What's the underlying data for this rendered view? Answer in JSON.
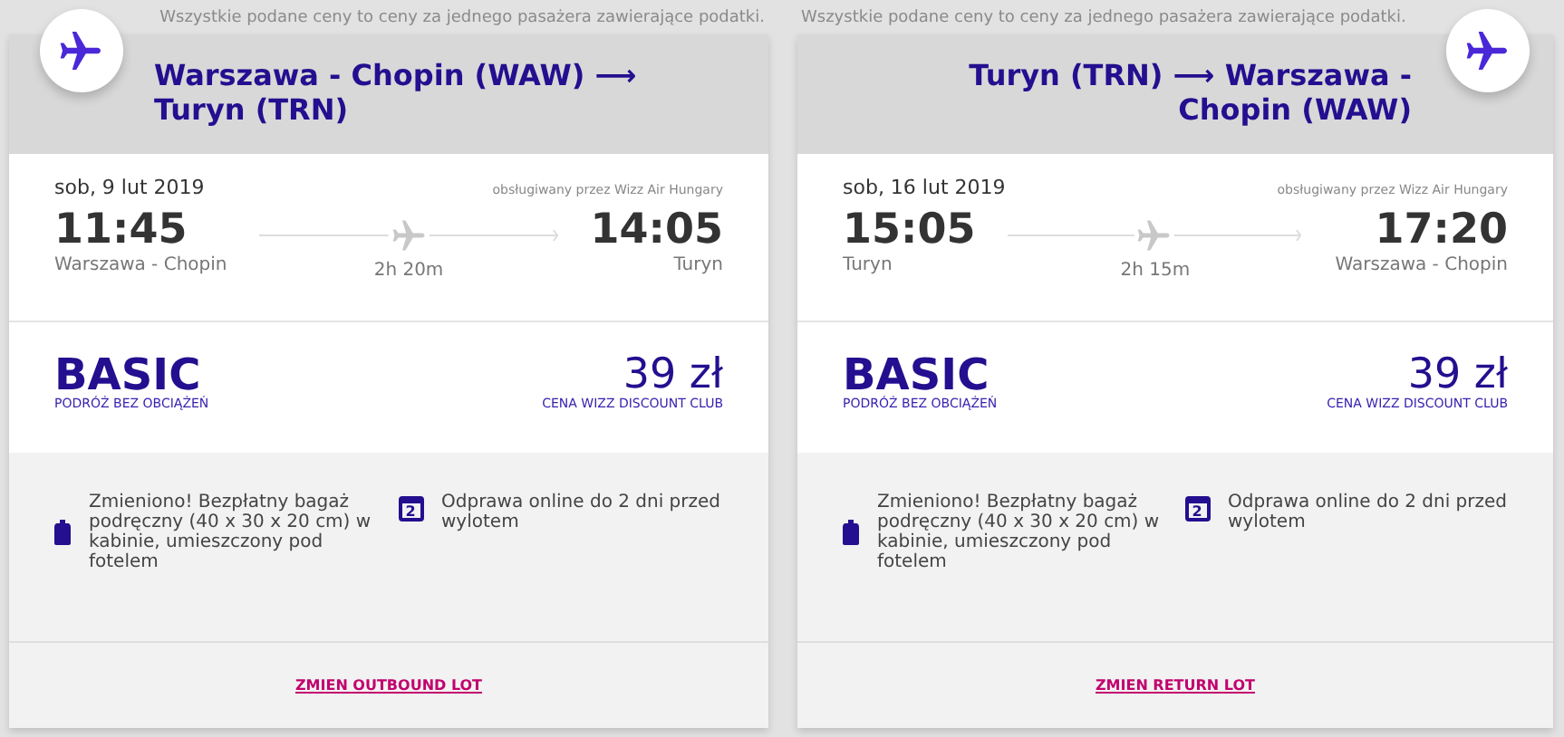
{
  "flights": [
    {
      "note": "Wszystkie podane ceny to ceny za jednego pasażera zawierające podatki.",
      "route": "Warszawa - Chopin (WAW) ⟶ Turyn (TRN)",
      "date": "sob, 9 lut 2019",
      "operator": "obsługiwany przez Wizz Air Hungary",
      "departure_time": "11:45",
      "departure_airport": "Warszawa - Chopin",
      "duration": "2h 20m",
      "arrival_time": "14:05",
      "arrival_airport": "Turyn",
      "fare": "BASIC",
      "fare_subtitle": "PODRÓŻ BEZ OBCIĄŻEŃ",
      "price": "39 zł",
      "price_note": "CENA WIZZ DISCOUNT CLUB",
      "features": [
        {
          "kind": "bag",
          "text": "Zmieniono! Bezpłatny bagaż podręczny (40 x 30 x 20 cm) w kabinie, umieszczony pod fotelem"
        },
        {
          "kind": "calendar",
          "icon_text": "2",
          "text": "Odprawa online do 2 dni przed wylotem"
        }
      ],
      "change_link": "ZMIEN OUTBOUND LOT"
    },
    {
      "note": "Wszystkie podane ceny to ceny za jednego pasażera zawierające podatki.",
      "route": "Turyn (TRN) ⟶ Warszawa - Chopin (WAW)",
      "date": "sob, 16 lut 2019",
      "operator": "obsługiwany przez Wizz Air Hungary",
      "departure_time": "15:05",
      "departure_airport": "Turyn",
      "duration": "2h 15m",
      "arrival_time": "17:20",
      "arrival_airport": "Warszawa - Chopin",
      "fare": "BASIC",
      "fare_subtitle": "PODRÓŻ BEZ OBCIĄŻEŃ",
      "price": "39 zł",
      "price_note": "CENA WIZZ DISCOUNT CLUB",
      "features": [
        {
          "kind": "bag",
          "text": "Zmieniono! Bezpłatny bagaż podręczny (40 x 30 x 20 cm) w kabinie, umieszczony pod fotelem"
        },
        {
          "kind": "calendar",
          "icon_text": "2",
          "text": "Odprawa online do 2 dni przed wylotem"
        }
      ],
      "change_link": "ZMIEN RETURN LOT"
    }
  ]
}
